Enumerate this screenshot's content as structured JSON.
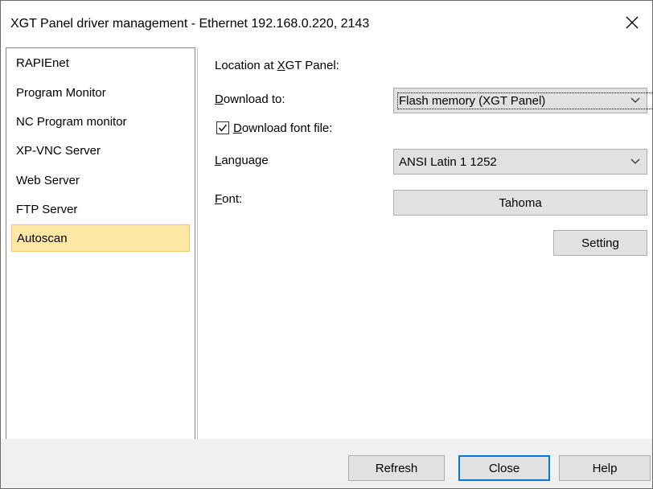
{
  "window": {
    "title": "XGT Panel driver management - Ethernet 192.168.0.220, 2143"
  },
  "sidebar": {
    "items": [
      {
        "label": "RAPIEnet"
      },
      {
        "label": "Program Monitor"
      },
      {
        "label": "NC Program monitor"
      },
      {
        "label": "XP-VNC Server"
      },
      {
        "label": "Web Server"
      },
      {
        "label": "FTP Server"
      },
      {
        "label": "Autoscan",
        "selected": true
      }
    ]
  },
  "form": {
    "location_label_pre": "Location at ",
    "location_label_ul": "X",
    "location_label_post": "GT Panel:",
    "download_to_label_ul": "D",
    "download_to_label_post": "ownload to:",
    "download_to_value": "Flash memory (XGT Panel)",
    "download_font_checked": true,
    "download_font_label_ul": "D",
    "download_font_label_post": "ownload font file:",
    "language_label_ul": "L",
    "language_label_post": "anguage",
    "language_value": "ANSI Latin 1 1252",
    "font_label_ul": "F",
    "font_label_post": "ont:",
    "font_button": "Tahoma",
    "setting_button": "Setting"
  },
  "footer": {
    "refresh": "Refresh",
    "close": "Close",
    "help": "Help"
  },
  "colors": {
    "selected_bg": "#ffe8a6",
    "focus_border": "#0078d7"
  },
  "icons": {
    "close": "close-icon",
    "dropdown": "chevron-down-icon",
    "check": "check-icon"
  }
}
